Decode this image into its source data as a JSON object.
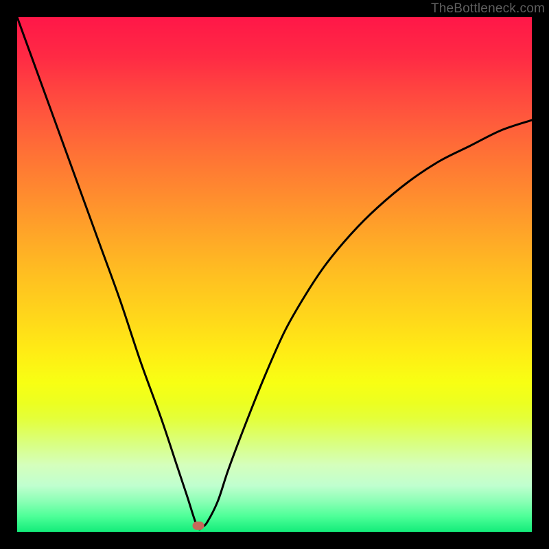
{
  "watermark": "TheBottleneck.com",
  "marker": {
    "x_pct": 35.2,
    "y_pct": 98.8
  },
  "chart_data": {
    "type": "line",
    "title": "",
    "xlabel": "",
    "ylabel": "",
    "xlim": [
      0,
      100
    ],
    "ylim": [
      0,
      100
    ],
    "grid": false,
    "legend": false,
    "series": [
      {
        "name": "bottleneck-curve",
        "x": [
          0,
          4,
          8,
          12,
          16,
          20,
          24,
          28,
          31,
          33,
          35,
          36,
          37,
          39,
          41,
          44,
          48,
          52,
          56,
          60,
          65,
          70,
          76,
          82,
          88,
          94,
          100
        ],
        "y": [
          100,
          89,
          78,
          67,
          56,
          45,
          33,
          22,
          13,
          7,
          1,
          1,
          2,
          6,
          12,
          20,
          30,
          39,
          46,
          52,
          58,
          63,
          68,
          72,
          75,
          78,
          80
        ]
      }
    ],
    "background_gradient": {
      "top": "#ff1748",
      "mid": "#ffd61b",
      "bottom": "#13ec7a"
    },
    "annotations": [
      {
        "type": "marker",
        "x": 35.2,
        "y": 1.2,
        "color": "#c56a5a"
      }
    ]
  }
}
